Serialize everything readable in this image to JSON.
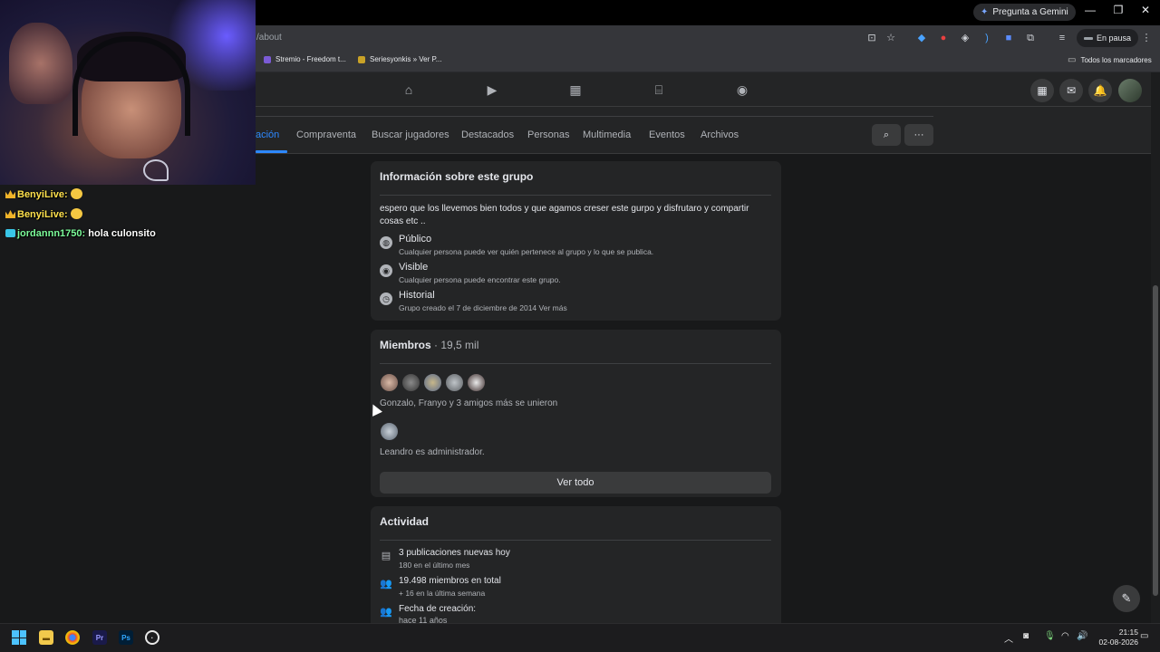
{
  "browser": {
    "gemini_button": "Pregunta a Gemini",
    "url_fragment": "/about",
    "paused_label": "En pausa",
    "bookmarks": [
      {
        "label": "Stremio - Freedom t...",
        "color": "#7b5bd6"
      },
      {
        "label": "Seriesyonkis » Ver P...",
        "color": "#c9a227"
      }
    ],
    "all_bookmarks": "Todos los marcadores"
  },
  "group_tabs": [
    {
      "label": "ación",
      "active": true
    },
    {
      "label": "Compraventa",
      "active": false
    },
    {
      "label": "Buscar jugadores",
      "active": false
    },
    {
      "label": "Destacados",
      "active": false
    },
    {
      "label": "Personas",
      "active": false
    },
    {
      "label": "Multimedia",
      "active": false
    },
    {
      "label": "Eventos",
      "active": false
    },
    {
      "label": "Archivos",
      "active": false
    }
  ],
  "about": {
    "title": "Información sobre este grupo",
    "description": "espero que los llevemos bien todos y que agamos creser este gurpo y disfrutaro y compartir cosas etc ..",
    "rows": [
      {
        "icon": "globe-icon",
        "title": "Público",
        "sub": "Cualquier persona puede ver quién pertenece al grupo y lo que se publica."
      },
      {
        "icon": "eye-icon",
        "title": "Visible",
        "sub": "Cualquier persona puede encontrar este grupo."
      },
      {
        "icon": "clock-icon",
        "title": "Historial",
        "sub": "Grupo creado el 7 de diciembre de 2014 Ver más"
      }
    ]
  },
  "members": {
    "title": "Miembros",
    "count": "· 19,5 mil",
    "joined_text": "Gonzalo, Franyo y 3 amigos más se unieron",
    "admin_text": "Leandro es administrador.",
    "see_all": "Ver todo"
  },
  "activity": {
    "title": "Actividad",
    "rows": [
      {
        "title": "3 publicaciones nuevas hoy",
        "sub": "180 en el último mes"
      },
      {
        "title": "19.498 miembros en total",
        "sub": "+ 16 en la última semana"
      },
      {
        "title": "Fecha de creación:",
        "sub": "hace 11 años"
      }
    ]
  },
  "chat": [
    {
      "badge": "crown",
      "name": "BenyiLive:",
      "message": ""
    },
    {
      "badge": "crown",
      "name": "BenyiLive:",
      "message": ""
    },
    {
      "badge": "cube",
      "name": "jordannn1750:",
      "message": "hola culonsito"
    }
  ],
  "taskbar": {
    "time": "21:15",
    "date": "02-08-2026"
  },
  "colors": {
    "accent": "#2d88ff",
    "card_bg": "#242526",
    "page_bg": "#18191a"
  }
}
